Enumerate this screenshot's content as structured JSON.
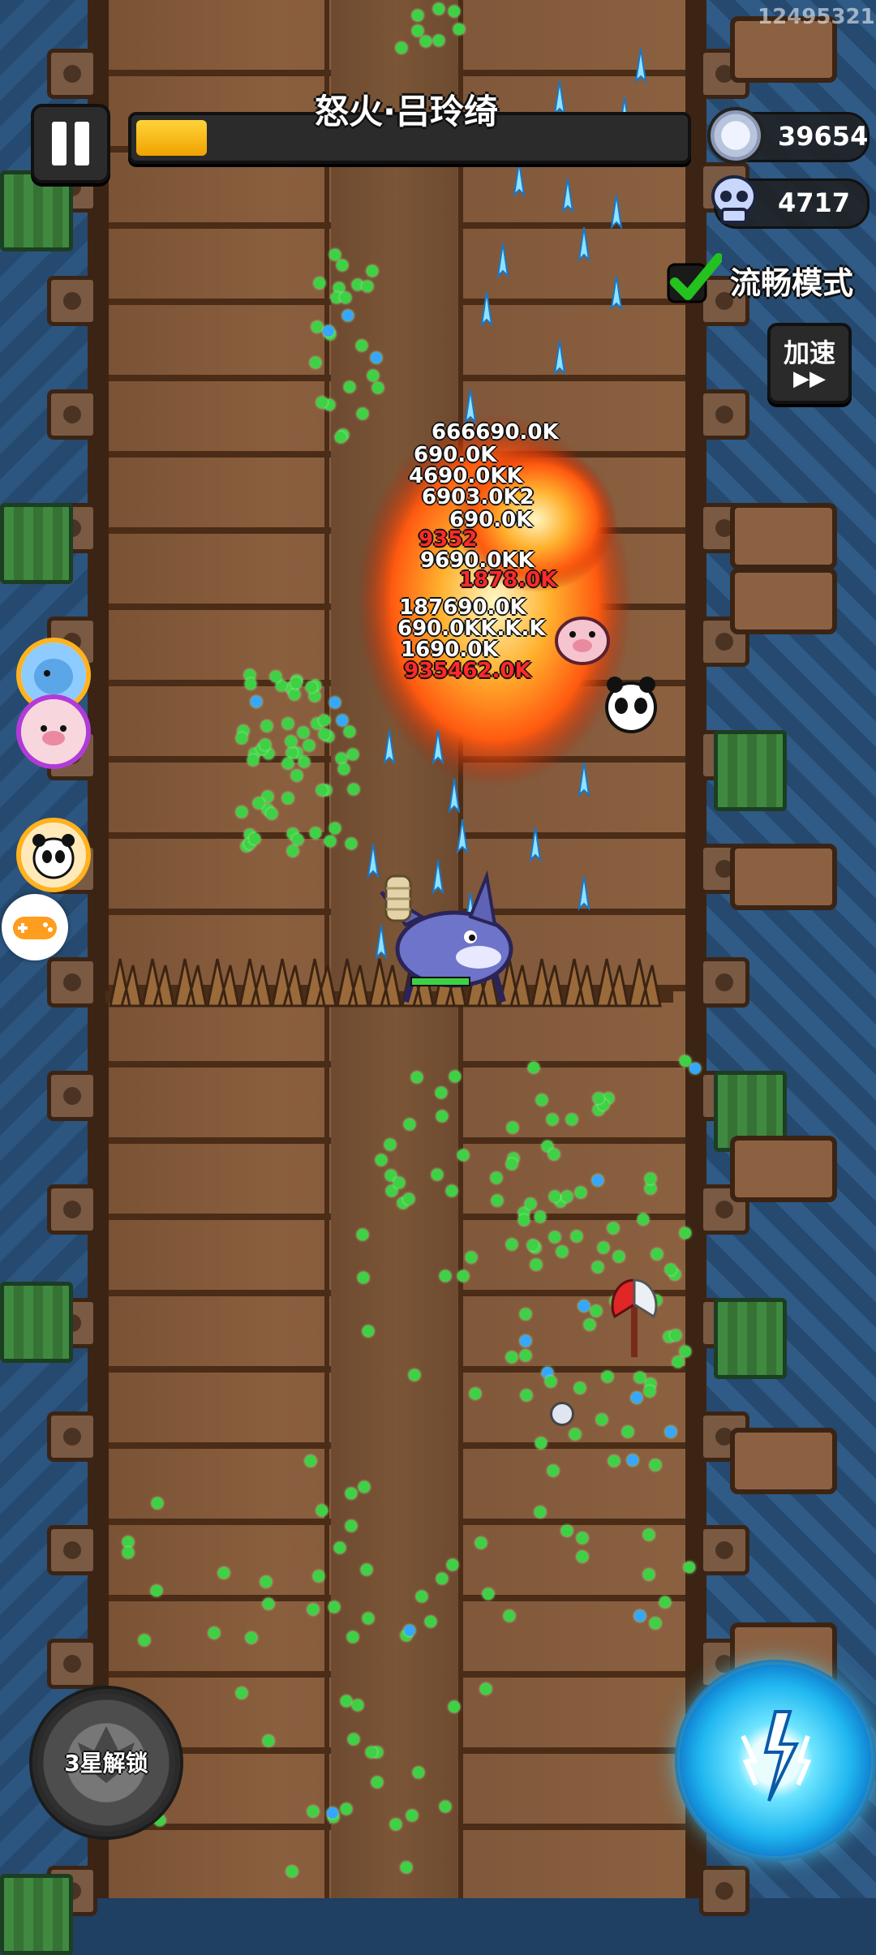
{
  "hud": {
    "boss_name": "怒火·吕玲绮",
    "boss_hp_fraction": 0.13,
    "coins": "39654",
    "kills": "4717",
    "smooth_mode_label": "流畅模式",
    "smooth_mode_checked": true,
    "speed_label": "加速",
    "speed_icon": "▶▶",
    "watermark": "12495321"
  },
  "skills": {
    "left_skill_label": "3星解锁",
    "right_skill_icon": "lightning-burst-icon"
  },
  "damage_numbers": [
    "666690.0K",
    "690.0K",
    "4690.0KK",
    "6903.0K2",
    "690.0K",
    "9352",
    "9690.0KK",
    "1878.0K",
    "187690.0K",
    "690.0KK.K.K",
    "1690.0K",
    "935462.0K"
  ],
  "colors": {
    "boss_bar_fill": "#f0a200",
    "gem": "#3fd145",
    "skill_glow": "#1fb6f0"
  }
}
